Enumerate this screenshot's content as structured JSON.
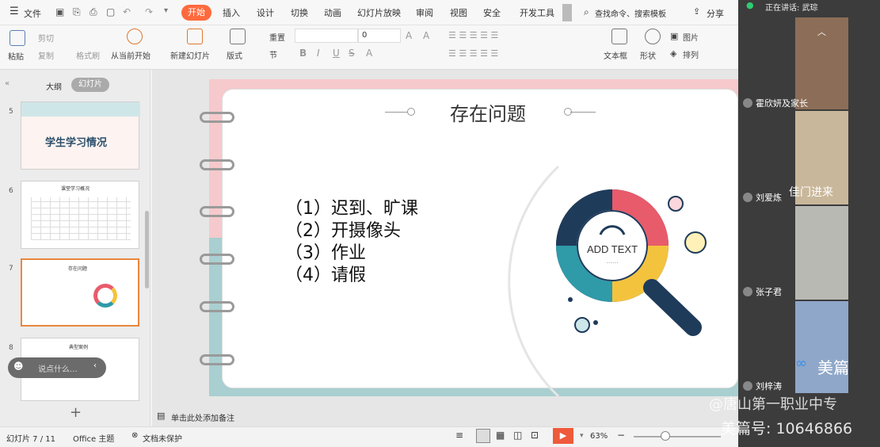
{
  "menu": {
    "file": "文件"
  },
  "tabs": [
    "开始",
    "插入",
    "设计",
    "切换",
    "动画",
    "幻灯片放映",
    "审阅",
    "视图",
    "安全",
    "开发工具"
  ],
  "search": {
    "placeholder": "查找命令、搜索模板"
  },
  "share": "分享",
  "ribbon": {
    "paste": "粘贴",
    "cut": "剪切",
    "copy": "复制",
    "format_painter": "格式刷",
    "play_from_current": "从当前开始",
    "new_slide": "新建幻灯片",
    "layout": "版式",
    "section": "节",
    "reset": "重置",
    "font_size": "0",
    "textbox": "文本框",
    "shape": "形状",
    "picture": "图片",
    "arrange": "排列"
  },
  "left_panel": {
    "outline_tab": "大纲",
    "slides_tab": "幻灯片",
    "thumbnails": [
      {
        "number": "5",
        "title": "学生学习情况"
      },
      {
        "number": "6",
        "title": "课堂学习概况"
      },
      {
        "number": "7",
        "title": "存在问题"
      },
      {
        "number": "8",
        "title": "典型案例"
      }
    ],
    "chat_placeholder": "说点什么...",
    "add": "+"
  },
  "slide": {
    "title": "存在问题",
    "items": [
      "（1）迟到、旷课",
      "（2）开摄像头",
      "（3）作业",
      "（4）请假"
    ],
    "graphic_text": "ADD TEXT",
    "graphic_dots": "......"
  },
  "notes": "单击此处添加备注",
  "status": {
    "slide_count": "幻灯片 7 / 11",
    "theme": "Office 主题",
    "protection": "文档未保护",
    "zoom": "63%"
  },
  "meeting": {
    "speaking": "正在讲话: 武琮",
    "participants": [
      {
        "name": "霍欣妍及家长"
      },
      {
        "name": "刘爱炼"
      },
      {
        "name": "张子君"
      },
      {
        "name": "刘梓涛"
      }
    ],
    "tile_caption": "佳门进来"
  },
  "watermark": {
    "brand": "美篇",
    "line1": "@唐山第一职业中专",
    "line2": "美篇号: 10646866"
  }
}
